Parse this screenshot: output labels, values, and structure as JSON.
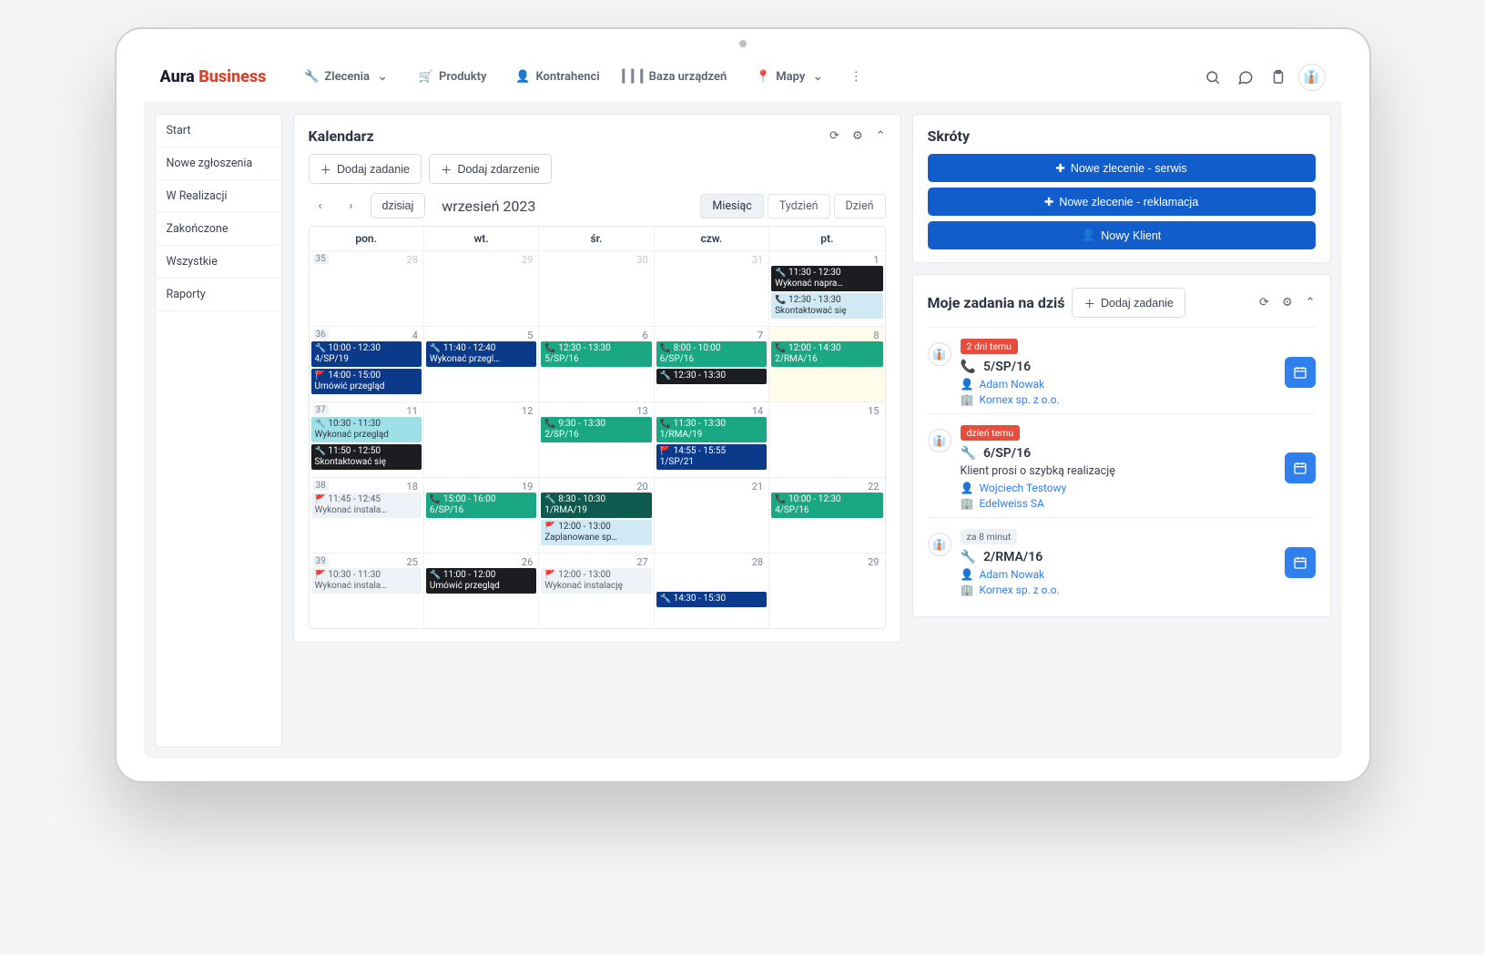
{
  "brand": {
    "part1": "Aura",
    "part2": "Business"
  },
  "nav": {
    "zlecenia": "Zlecenia",
    "produkty": "Produkty",
    "kontrahenci": "Kontrahenci",
    "baza": "Baza urządzeń",
    "mapy": "Mapy"
  },
  "sidebar": {
    "start": "Start",
    "nowe": "Nowe zgłoszenia",
    "wrealizacji": "W Realizacji",
    "zakonczone": "Zakończone",
    "wszystkie": "Wszystkie",
    "raporty": "Raporty"
  },
  "calendar": {
    "title": "Kalendarz",
    "add_task": "Dodaj zadanie",
    "add_event": "Dodaj zdarzenie",
    "today": "dzisiaj",
    "period": "wrzesień 2023",
    "view_month": "Miesiąc",
    "view_week": "Tydzień",
    "view_day": "Dzień",
    "dow": {
      "mon": "pon.",
      "tue": "wt.",
      "wed": "śr.",
      "thu": "czw.",
      "fri": "pt."
    },
    "weeks": {
      "w35": "35",
      "d28": "28",
      "d29": "29",
      "d30": "30",
      "d31": "31",
      "d1": "1",
      "w36": "36",
      "d4": "4",
      "d5": "5",
      "d6": "6",
      "d7": "7",
      "d8": "8",
      "w37": "37",
      "d11": "11",
      "d12": "12",
      "d13": "13",
      "d14": "14",
      "d15": "15",
      "w38": "38",
      "d18": "18",
      "d19": "19",
      "d20": "20",
      "d21": "21",
      "d22": "22",
      "w39": "39",
      "d25": "25",
      "d26": "26",
      "d27": "27",
      "d28b": "28",
      "d29b": "29"
    },
    "events": {
      "r1f_a": {
        "time": "🔧 11:30 - 12:30",
        "desc": "Wykonać napra…"
      },
      "r1f_b": {
        "time": "📞 12:30 - 13:30",
        "desc": "Skontaktować się"
      },
      "r2a_a": {
        "time": "🔧 10:00 - 12:30",
        "desc": "4/SP/19"
      },
      "r2a_b": {
        "time": "🚩 14:00 - 15:00",
        "desc": "Umówić przegląd"
      },
      "r2b_a": {
        "time": "🔧 11:40 - 12:40",
        "desc": "Wykonać przegl…"
      },
      "r2c_a": {
        "time": "📞 12:30 - 13:30",
        "desc": "5/SP/16"
      },
      "r2d_a": {
        "time": "📞 8:00 - 10:00",
        "desc": "6/SP/16"
      },
      "r2d_b": {
        "time": "🔧 12:30 - 13:30",
        "desc": ""
      },
      "r2e_a": {
        "time": "📞 12:00 - 14:30",
        "desc": "2/RMA/16"
      },
      "r3a_a": {
        "time": "🔧 10:30 - 11:30",
        "desc": "Wykonać przegląd"
      },
      "r3a_b": {
        "time": "🔧 11:50 - 12:50",
        "desc": "Skontaktować się"
      },
      "r3c_a": {
        "time": "📞 9:30 - 13:30",
        "desc": "2/SP/16"
      },
      "r3d_a": {
        "time": "📞 11:30 - 13:30",
        "desc": "1/RMA/19"
      },
      "r3d_b": {
        "time": "🚩 14:55 - 15:55",
        "desc": "1/SP/21"
      },
      "r4a_a": {
        "time": "🚩 11:45 - 12:45",
        "desc": "Wykonać instala…"
      },
      "r4b_a": {
        "time": "📞 15:00 - 16:00",
        "desc": "6/SP/16"
      },
      "r4c_a": {
        "time": "🔧 8:30 - 10:30",
        "desc": "1/RMA/19"
      },
      "r4c_b": {
        "time": "🚩 12:00 - 13:00",
        "desc": "Zaplanowane sp…"
      },
      "r4e_a": {
        "time": "📞 10:00 - 12:30",
        "desc": "4/SP/16"
      },
      "r5a_a": {
        "time": "🚩 10:30 - 11:30",
        "desc": "Wykonać instala…"
      },
      "r5b_a": {
        "time": "🔧 11:00 - 12:00",
        "desc": "Umówić przegląd"
      },
      "r5c_a": {
        "time": "🚩 12:00 - 13:00",
        "desc": "Wykonać instalację"
      },
      "r5d_a": {
        "time": "🔧 14:30 - 15:30",
        "desc": ""
      }
    }
  },
  "shortcuts": {
    "title": "Skróty",
    "serwis": "Nowe zlecenie - serwis",
    "reklamacja": "Nowe zlecenie - reklamacja",
    "klient": "Nowy Klient"
  },
  "tasks": {
    "title": "Moje zadania na dziś",
    "add": "Dodaj zadanie",
    "t1": {
      "badge": "2 dni temu",
      "title": "5/SP/16",
      "person": "Adam Nowak",
      "company": "Kornex sp. z o.o."
    },
    "t2": {
      "badge": "dzień temu",
      "title": "6/SP/16",
      "note": "Klient prosi o szybką realizację",
      "person": "Wojciech Testowy",
      "company": "Edelweiss SA"
    },
    "t3": {
      "badge": "za 8 minut",
      "title": "2/RMA/16",
      "person": "Adam Nowak",
      "company": "Kornex sp. z o.o."
    }
  }
}
